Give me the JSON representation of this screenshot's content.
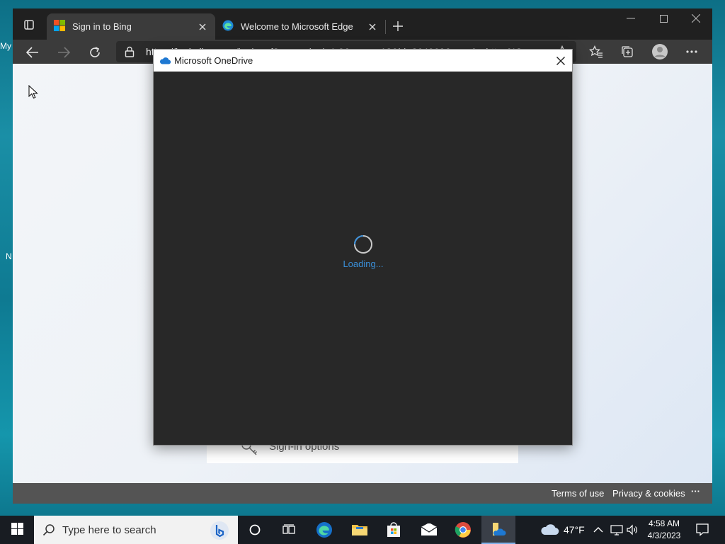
{
  "desktop": {
    "edge_labels": [
      "My",
      "N"
    ]
  },
  "browser": {
    "tabs": [
      {
        "label": "Sign in to Bing"
      },
      {
        "label": "Welcome to Microsoft Edge"
      }
    ],
    "address": {
      "url_prefix": "https://",
      "url_host": "login.live.com",
      "url_rest": "/login.srf?wa=wsignin1.0&rpsnv=13&id=264960&wreply=https%3a"
    },
    "footer": {
      "terms": "Terms of use",
      "privacy": "Privacy & cookies",
      "more": "···"
    },
    "page": {
      "signin_options": "Sign-in options"
    }
  },
  "dialog": {
    "title": "Microsoft OneDrive",
    "loading": "Loading..."
  },
  "taskbar": {
    "search_placeholder": "Type here to search",
    "weather": "47°F",
    "time": "4:58 AM",
    "date": "4/3/2023"
  },
  "colors": {
    "accent": "#3a8fd9",
    "taskbar": "#181c22",
    "dialog_bg": "#282828"
  }
}
